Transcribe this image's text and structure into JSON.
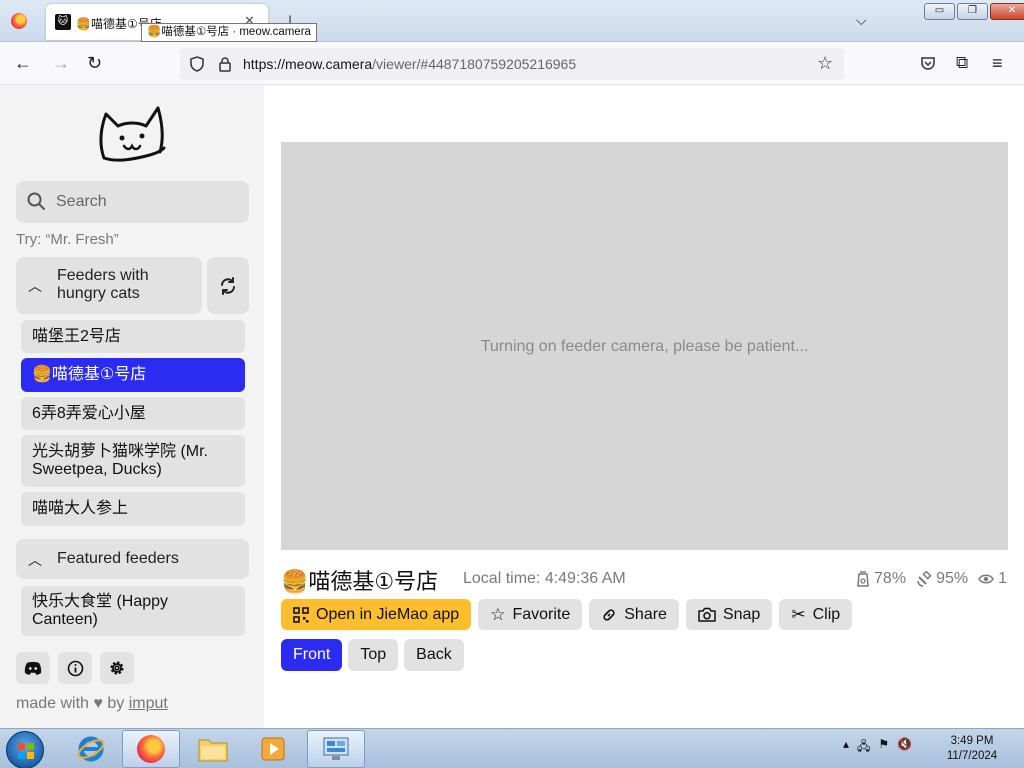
{
  "browser": {
    "tab_title": "🍔喵德基①号店",
    "tooltip": "🍔喵德基①号店 · meow.camera",
    "url_domain": "https://meow.camera",
    "url_path": "/viewer/#4487180759205216965",
    "window_buttons": [
      "▭",
      "❐",
      "✕"
    ]
  },
  "sidebar": {
    "search_placeholder": "Search",
    "try_hint": "Try: “Mr. Fresh”",
    "section_hungry": "Feeders with hungry cats",
    "feeders_hungry": [
      "喵堡王2号店",
      "🍔喵德基①号店",
      "6弄8弄爱心小屋",
      "光头胡萝卜猫咪学院 (Mr. Sweetpea, Ducks)",
      "喵喵大人参上"
    ],
    "active_feeder_index": 1,
    "section_featured": "Featured feeders",
    "feeders_featured": [
      "快乐大食堂 (Happy Canteen)"
    ],
    "footer_text": "made with",
    "footer_by": "by",
    "footer_link": "imput"
  },
  "main": {
    "video_message": "Turning on feeder camera, please be patient...",
    "feeder_title": "🍔喵德基①号店",
    "local_time": "Local time: 4:49:36 AM",
    "stat_food": "78%",
    "stat_battery": "95%",
    "stat_viewers": "1",
    "actions": {
      "open_app": "Open in JieMao app",
      "favorite": "Favorite",
      "share": "Share",
      "snap": "Snap",
      "clip": "Clip"
    },
    "cameras": [
      "Front",
      "Top",
      "Back"
    ],
    "active_camera_index": 0
  },
  "taskbar": {
    "time": "3:49 PM",
    "date": "11/7/2024"
  },
  "colors": {
    "accent": "#2b2bf2",
    "app_button": "#fcbe2f",
    "panel": "#e2e2e2"
  }
}
